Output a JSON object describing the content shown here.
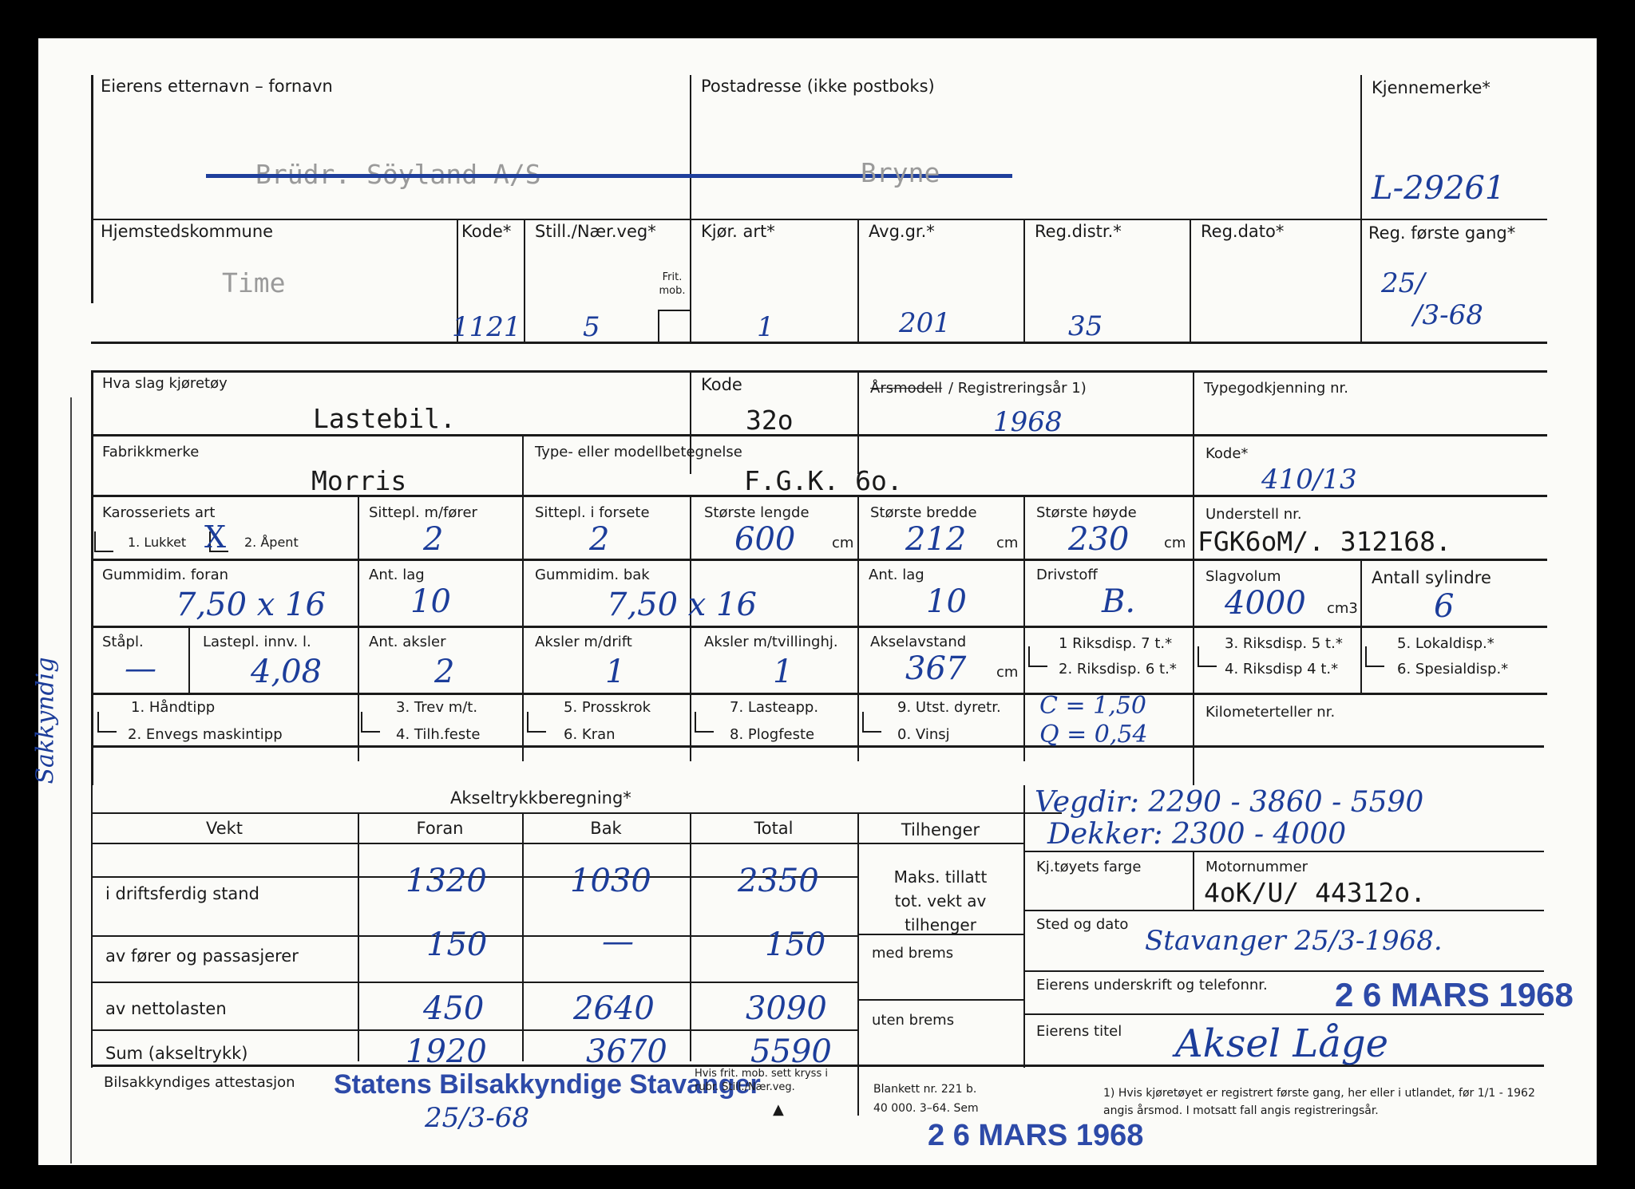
{
  "section1": {
    "owner_label": "Eierens etternavn – fornavn",
    "owner_value": "Brüdr. Söyland A/S",
    "address_label": "Postadresse (ikke postboks)",
    "address_value": "Bryne",
    "plate_label": "Kjennemerke*",
    "plate_value": "L-29261",
    "municipality_label": "Hjemstedskommune",
    "municipality_value": "Time",
    "code_label": "Kode*",
    "code_value": "1121",
    "still_label": "Still./Nær.veg*",
    "still_value": "5",
    "frit_label": "Frit. mob.",
    "kjor_label": "Kjør. art*",
    "kjor_value": "1",
    "avg_label": "Avg.gr.*",
    "avg_value": "201",
    "regdistr_label": "Reg.distr.*",
    "regdistr_value": "35",
    "regdato_label": "Reg.dato*",
    "regforste_label": "Reg. første gang*",
    "regforste_value1": "25/",
    "regforste_value2": "/3-68"
  },
  "section2": {
    "vehicle_label": "Hva slag kjøretøy",
    "vehicle_value": "Lastebil.",
    "kode_label": "Kode",
    "kode_value": "32o",
    "arsmodell_label": "Årsmodell",
    "regyear_label": "/ Registreringsår 1)",
    "regyear_value": "1968",
    "typegodkj_label": "Typegodkjenning nr.",
    "make_label": "Fabrikkmerke",
    "make_value": "Morris",
    "model_label": "Type- eller modellbetegnelse",
    "model_value": "F.G.K. 6o.",
    "kode2_label": "Kode*",
    "kode2_value": "410/13",
    "body_label": "Karosseriets art",
    "body_opt1": "1. Lukket",
    "body_opt2": "2. Åpent",
    "body_check": "X",
    "seats_label": "Sittepl. m/fører",
    "seats_value": "2",
    "seats_front_label": "Sittepl. i forsete",
    "seats_front_value": "2",
    "length_label": "Største lengde",
    "length_value": "600",
    "width_label": "Største bredde",
    "width_value": "212",
    "height_label": "Største høyde",
    "height_value": "230",
    "cm": "cm",
    "chassis_label": "Understell nr.",
    "chassis_value": "FGK6oM/. 312168.",
    "tyre_front_label": "Gummidim. foran",
    "tyre_front_value": "7,50 x 16",
    "antlag_label": "Ant. lag",
    "antlag_front_value": "10",
    "tyre_rear_label": "Gummidim. bak",
    "tyre_rear_value": "7,50 x 16",
    "antlag_rear_value": "10",
    "fuel_label": "Drivstoff",
    "fuel_value": "B.",
    "displacement_label": "Slagvolum",
    "displacement_value": "4000",
    "cm3": "cm3",
    "cylinders_label": "Antall sylindre",
    "cylinders_value": "6",
    "stapl_label": "Ståpl.",
    "stapl_value": "—",
    "lastepl_label": "Lastepl. innv. l.",
    "lastepl_value": "4,08",
    "aksler_label": "Ant. aksler",
    "aksler_value": "2",
    "aksler_drift_label": "Aksler m/drift",
    "aksler_drift_value": "1",
    "aksler_tvilling_label": "Aksler m/tvillinghj.",
    "aksler_tvilling_value": "1",
    "akselavstand_label": "Akselavstand",
    "akselavstand_value": "367",
    "riks1": "1 Riksdisp. 7 t.*",
    "riks2": "2. Riksdisp. 6 t.*",
    "riks3": "3. Riksdisp. 5 t.*",
    "riks4": "4. Riksdisp 4 t.*",
    "riks5": "5. Lokaldisp.*",
    "riks6": "6. Spesialdisp.*",
    "opt1": "1. Håndtipp",
    "opt2": "2. Envegs maskintipp",
    "opt3": "3. Trev m/t.",
    "opt4": "4. Tilh.feste",
    "opt5": "5. Prosskrok",
    "opt6": "6. Kran",
    "opt7": "7. Lasteapp.",
    "opt8": "8. Plogfeste",
    "opt9": "9. Utst. dyretr.",
    "opt0": "0. Vinsj",
    "c_value": "C = 1,50",
    "q_value": "Q = 0,54",
    "km_label": "Kilometerteller nr."
  },
  "axle": {
    "title": "Akseltrykkberegning*",
    "headers": [
      "Vekt",
      "Foran",
      "Bak",
      "Total",
      "Tilhenger"
    ],
    "rows": [
      {
        "label": "i driftsferdig stand",
        "foran": "1320",
        "bak": "1030",
        "total": "2350"
      },
      {
        "label": "av fører og passasjerer",
        "foran": "150",
        "bak": "—",
        "total": "150"
      },
      {
        "label": "av nettolasten",
        "foran": "450",
        "bak": "2640",
        "total": "3090"
      },
      {
        "label": "Sum (akseltrykk)",
        "foran": "1920",
        "bak": "3670",
        "total": "5590"
      }
    ],
    "tilh_text": "Maks. tillatt tot. vekt av tilhenger",
    "med_brems": "med brems",
    "uten_brems": "uten brems"
  },
  "right": {
    "vegdir_line": "Vegdir: 2290 - 3860 - 5590",
    "dekker_line": "Dekker: 2300 - 4000",
    "color_label": "Kj.tøyets farge",
    "motor_label": "Motornummer",
    "motor_value": "4oK/U/ 44312o.",
    "place_label": "Sted og dato",
    "place_value": "Stavanger 25/3-1968.",
    "signature_label": "Eierens underskrift og telefonnr.",
    "date_stamp": "2 6 MARS 1968",
    "title_label": "Eierens titel",
    "title_signature": "Aksel Låge"
  },
  "footer": {
    "attest_label": "Bilsakkyndiges attestasjon",
    "attest_stamp": "Statens Bilsakkyndige Stavanger",
    "attest_date": "25/3-68",
    "hvis_text": "Hvis frit. mob. sett kryss i rubr. Still./Nær.veg.",
    "blankett": "Blankett nr. 221 b.",
    "print_info": "40 000. 3–64. Sem",
    "note": "1) Hvis kjøretøyet er registrert første gang, her eller i utlandet, før 1/1 - 1962 angis årsmod. I motsatt fall angis registreringsår.",
    "bottom_stamp": "2 6 MARS 1968",
    "side_note": "Sakkyndig"
  }
}
